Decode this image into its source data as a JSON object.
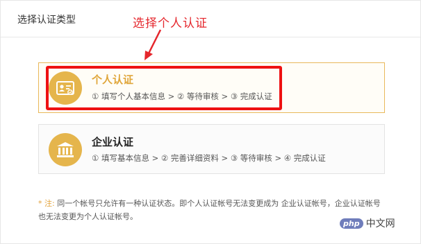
{
  "header": {
    "title": "选择认证类型"
  },
  "annotation": {
    "text": "选择个人认证",
    "color": "#e5262c"
  },
  "cards": [
    {
      "title": "个人认证",
      "steps": "① 填写个人基本信息 > ② 等待审核 > ③ 完成认证",
      "icon": "id-card-icon",
      "selected": true
    },
    {
      "title": "企业认证",
      "steps": "① 填写基本信息 > ② 完善详细资料 > ③ 等待审核 > ④ 完成认证",
      "icon": "bank-building-icon",
      "selected": false
    }
  ],
  "note": {
    "label": "* 注:",
    "text": " 同一个帐号只允许有一种认证状态。即个人认证帐号无法变更成为 企业认证帐号，企业认证帐号也无法变更为个人认证帐号。"
  },
  "watermark": {
    "badge": "php",
    "text": "中文网"
  },
  "colors": {
    "accent": "#e5b54c",
    "highlight": "#ee1111"
  }
}
